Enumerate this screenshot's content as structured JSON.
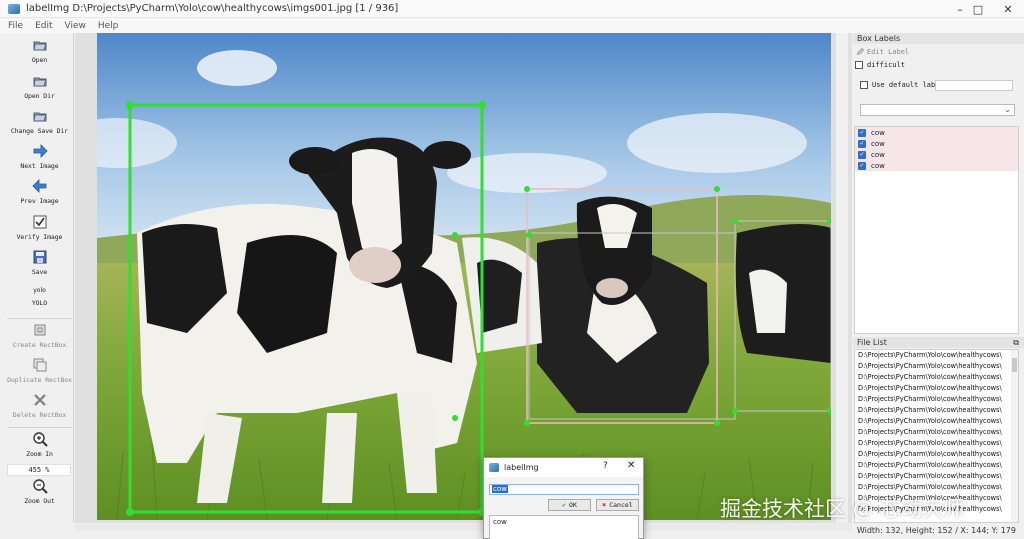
{
  "window": {
    "title": "labelImg D:\\Projects\\PyCharm\\Yolo\\cow\\healthycows\\imgs001.jpg [1 / 936]",
    "controls": [
      "–",
      "□",
      "✕"
    ]
  },
  "menu": [
    "File",
    "Edit",
    "View",
    "Help"
  ],
  "toolbar": {
    "open": "Open",
    "open_dir": "Open Dir",
    "change_save_dir": "Change Save Dir",
    "next_image": "Next Image",
    "prev_image": "Prev Image",
    "verify_image": "Verify Image",
    "save": "Save",
    "format_icon_text": "yolo",
    "format": "YOLO",
    "create_rectbox": "Create RectBox",
    "duplicate_rectbox": "Duplicate RectBox",
    "delete_rectbox": "Delete RectBox",
    "zoom_in": "Zoom In",
    "zoom_value": "455 %",
    "zoom_out": "Zoom Out"
  },
  "box_labels_dock": {
    "title": "Box Labels",
    "edit_label": "Edit Label",
    "difficult": "difficult",
    "use_default_label": "Use default label",
    "default_label_value": "",
    "combo_value": "",
    "labels": [
      "cow",
      "cow",
      "cow",
      "cow"
    ]
  },
  "file_list_dock": {
    "title": "File List",
    "files": [
      "D:\\Projects\\PyCharm\\Yolo\\cow\\healthycows\\",
      "D:\\Projects\\PyCharm\\Yolo\\cow\\healthycows\\",
      "D:\\Projects\\PyCharm\\Yolo\\cow\\healthycows\\",
      "D:\\Projects\\PyCharm\\Yolo\\cow\\healthycows\\",
      "D:\\Projects\\PyCharm\\Yolo\\cow\\healthycows\\",
      "D:\\Projects\\PyCharm\\Yolo\\cow\\healthycows\\",
      "D:\\Projects\\PyCharm\\Yolo\\cow\\healthycows\\",
      "D:\\Projects\\PyCharm\\Yolo\\cow\\healthycows\\",
      "D:\\Projects\\PyCharm\\Yolo\\cow\\healthycows\\",
      "D:\\Projects\\PyCharm\\Yolo\\cow\\healthycows\\",
      "D:\\Projects\\PyCharm\\Yolo\\cow\\healthycows\\",
      "D:\\Projects\\PyCharm\\Yolo\\cow\\healthycows\\",
      "D:\\Projects\\PyCharm\\Yolo\\cow\\healthycows\\",
      "D:\\Projects\\PyCharm\\Yolo\\cow\\healthycows\\",
      "D:\\Projects\\PyCharm\\Yolo\\cow\\healthycows\\"
    ]
  },
  "dialog": {
    "title": "labelImg",
    "help": "?",
    "close": "✕",
    "input_value": "cow",
    "ok": "OK",
    "cancel": "Cancel",
    "list_items": [
      "cow"
    ]
  },
  "status": "Width: 132, Height: 152 / X: 144; Y: 179",
  "watermark": "掘金技术社区 @ 芯动大师",
  "colors": {
    "box_active": "#33dd33",
    "box_inactive": "#f0b8c4",
    "selection": "#2b6fd0",
    "label_row_bg": "#f6e6ea"
  }
}
